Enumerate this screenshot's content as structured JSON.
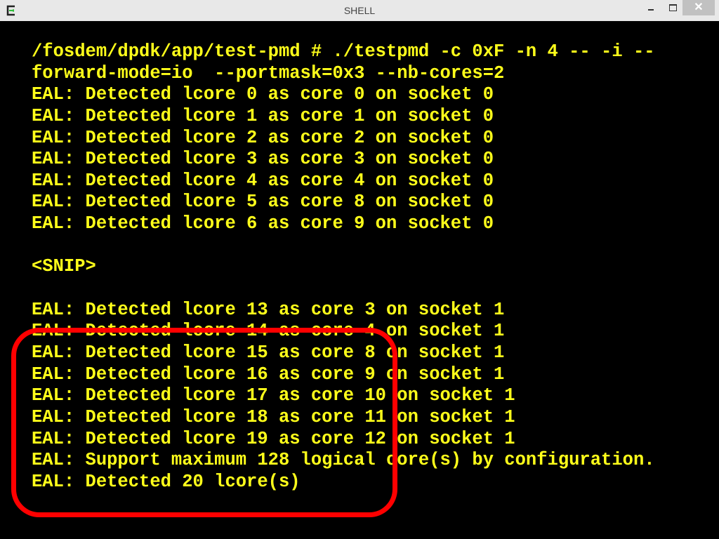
{
  "window": {
    "title": "SHELL",
    "app_icon": "terminal-icon",
    "controls": {
      "minimize": "minimize-icon",
      "maximize": "maximize-icon",
      "close": "close-icon",
      "close_glyph": "✕"
    }
  },
  "terminal": {
    "text_color": "#ffff1a",
    "background": "#000000",
    "lines": [
      "/fosdem/dpdk/app/test-pmd # ./testpmd -c 0xF -n 4 -- -i --",
      "forward-mode=io  --portmask=0x3 --nb-cores=2",
      "EAL: Detected lcore 0 as core 0 on socket 0",
      "EAL: Detected lcore 1 as core 1 on socket 0",
      "EAL: Detected lcore 2 as core 2 on socket 0",
      "EAL: Detected lcore 3 as core 3 on socket 0",
      "EAL: Detected lcore 4 as core 4 on socket 0",
      "EAL: Detected lcore 5 as core 8 on socket 0",
      "EAL: Detected lcore 6 as core 9 on socket 0",
      "",
      "<SNIP>",
      "",
      "EAL: Detected lcore 13 as core 3 on socket 1",
      "EAL: Detected lcore 14 as core 4 on socket 1",
      "EAL: Detected lcore 15 as core 8 on socket 1",
      "EAL: Detected lcore 16 as core 9 on socket 1",
      "EAL: Detected lcore 17 as core 10 on socket 1",
      "EAL: Detected lcore 18 as core 11 on socket 1",
      "EAL: Detected lcore 19 as core 12 on socket 1",
      "EAL: Support maximum 128 logical core(s) by configuration.",
      "EAL: Detected 20 lcore(s)"
    ]
  },
  "annotation": {
    "type": "highlight-box",
    "color": "#ff0000"
  }
}
